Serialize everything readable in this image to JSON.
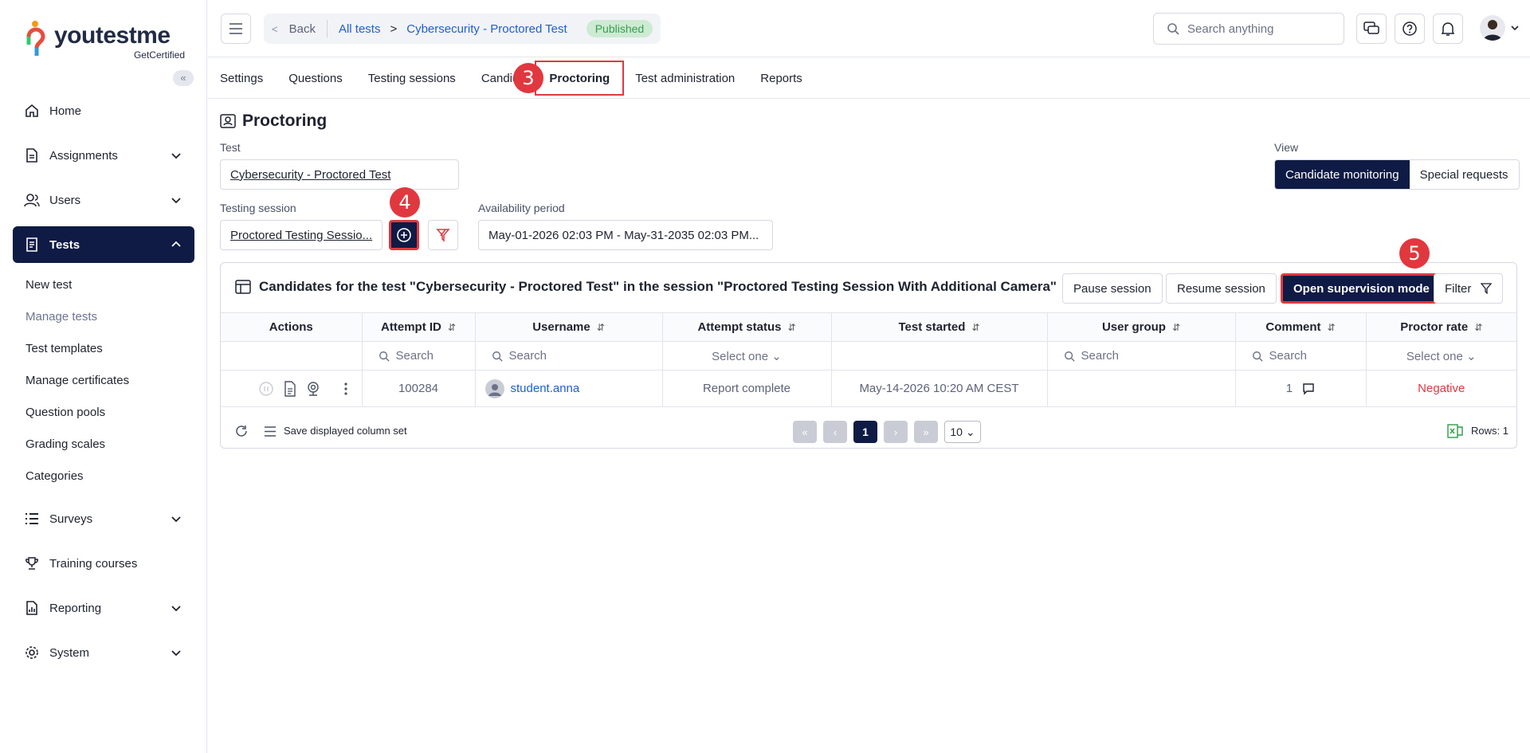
{
  "app": {
    "logo_text": "youtestme",
    "logo_sub": "GetCertified"
  },
  "sidebar": {
    "items": [
      {
        "label": "Home",
        "icon": "home-icon",
        "expandable": false
      },
      {
        "label": "Assignments",
        "icon": "document-icon",
        "expandable": true
      },
      {
        "label": "Users",
        "icon": "users-icon",
        "expandable": true
      },
      {
        "label": "Tests",
        "icon": "test-icon",
        "expandable": true,
        "active": true
      },
      {
        "label": "Surveys",
        "icon": "list-icon",
        "expandable": true
      },
      {
        "label": "Training courses",
        "icon": "trophy-icon",
        "expandable": false
      },
      {
        "label": "Reporting",
        "icon": "report-icon",
        "expandable": true
      },
      {
        "label": "System",
        "icon": "gear-icon",
        "expandable": true
      }
    ],
    "tests_sub": [
      "New test",
      "Manage tests",
      "Test templates",
      "Manage certificates",
      "Question pools",
      "Grading scales",
      "Categories"
    ],
    "collapse_label": "«"
  },
  "header": {
    "back": "Back",
    "crumb1": "All tests",
    "sep": ">",
    "crumb2": "Cybersecurity - Proctored Test",
    "status": "Published",
    "search_placeholder": "Search anything"
  },
  "tabs": [
    "Settings",
    "Questions",
    "Testing sessions",
    "Candid",
    "Proctoring",
    "Test administration",
    "Reports"
  ],
  "markers": {
    "m3": "3",
    "m4": "4",
    "m5": "5"
  },
  "page": {
    "title": "Proctoring",
    "test_label": "Test",
    "test_value": "Cybersecurity - Proctored Test",
    "session_label": "Testing session",
    "session_value": "Proctored Testing Sessio...",
    "availability_label": "Availability period",
    "availability_value": "May-01-2026 02:03 PM - May-31-2035 02:03 PM...",
    "view_label": "View",
    "view_on": "Candidate monitoring",
    "view_off": "Special requests"
  },
  "card": {
    "title": "Candidates for the test \"Cybersecurity - Proctored Test\" in the session \"Proctored Testing Session With Additional Camera\"",
    "pause": "Pause session",
    "resume": "Resume session",
    "supervise": "Open supervision mode",
    "filter": "Filter"
  },
  "table": {
    "columns": [
      "Actions",
      "Attempt ID",
      "Username",
      "Attempt status",
      "Test started",
      "User group",
      "Comment",
      "Proctor rate"
    ],
    "filters": {
      "search": "Search",
      "select": "Select one"
    },
    "rows": [
      {
        "attempt_id": "100284",
        "username": "student.anna",
        "status": "Report complete",
        "started": "May-14-2026 10:20 AM CEST",
        "group": "",
        "comment": "1",
        "rate": "Negative"
      }
    ]
  },
  "footer": {
    "save_columns": "Save displayed column set",
    "page": "1",
    "rows_per_page": "10",
    "rows_count": "Rows: 1"
  }
}
